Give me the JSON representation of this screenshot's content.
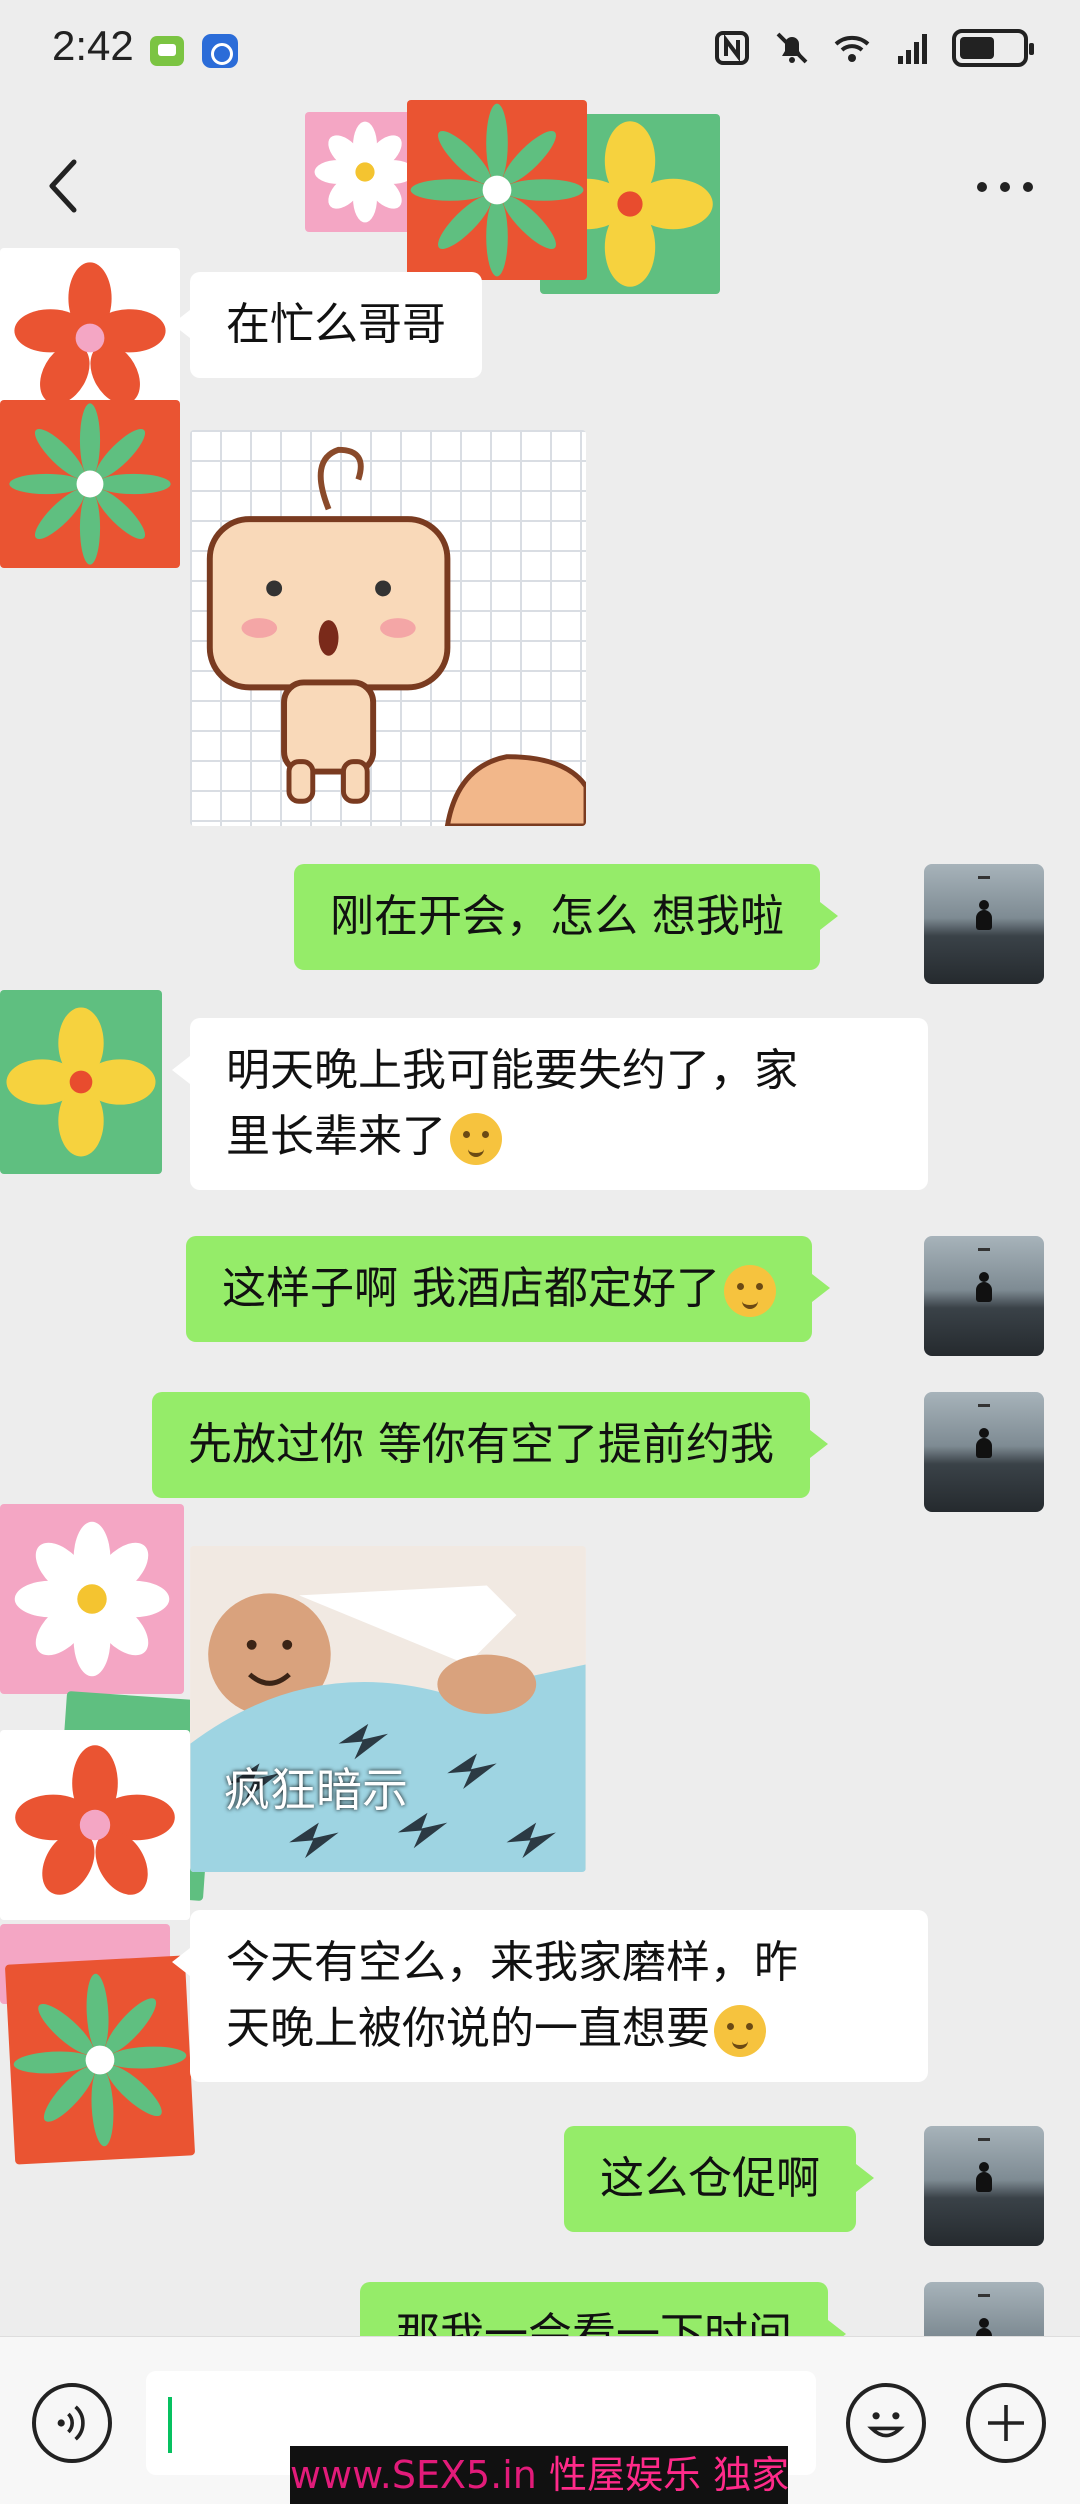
{
  "status_bar": {
    "time": "2:42",
    "icons": [
      "messages-app-icon",
      "app-icon",
      "nfc-icon",
      "mute-icon",
      "wifi-icon",
      "4g-signal-icon",
      "battery-icon"
    ]
  },
  "header": {
    "back_icon": "chevron-left-icon",
    "more_icon": "more-dots-icon"
  },
  "messages": [
    {
      "side": "in",
      "type": "text",
      "text": "在忙么哥哥"
    },
    {
      "side": "in",
      "type": "sticker",
      "description_icon": "cartoon-sticker"
    },
    {
      "side": "out",
      "type": "text",
      "text": "刚在开会，怎么 想我啦"
    },
    {
      "side": "in",
      "type": "text",
      "line1": "明天晚上我可能要失约了，家",
      "line2": "里长辈来了"
    },
    {
      "side": "out",
      "type": "text",
      "text": "这样子啊 我酒店都定好了"
    },
    {
      "side": "out",
      "type": "text",
      "text": "先放过你 等你有空了提前约我"
    },
    {
      "side": "in",
      "type": "sticker",
      "caption": "疯狂暗示"
    },
    {
      "side": "in",
      "type": "text",
      "line1": "今天有空么，来我家磨样，昨",
      "line2": "天晚上被你说的一直想要"
    },
    {
      "side": "out",
      "type": "text",
      "text": "这么仓促啊"
    },
    {
      "side": "out",
      "type": "text",
      "text": "那我一会看一下时间"
    }
  ],
  "input_bar": {
    "voice_icon": "voice-icon",
    "emoji_icon": "emoji-icon",
    "plus_icon": "plus-icon",
    "value": ""
  },
  "watermark": {
    "url": "www.SEX5.in",
    "text": "性屋娱乐 独家发布"
  },
  "colors": {
    "background": "#ededed",
    "outgoing_bubble": "#95ec69",
    "incoming_bubble": "#ffffff",
    "accent": "#07c160"
  }
}
